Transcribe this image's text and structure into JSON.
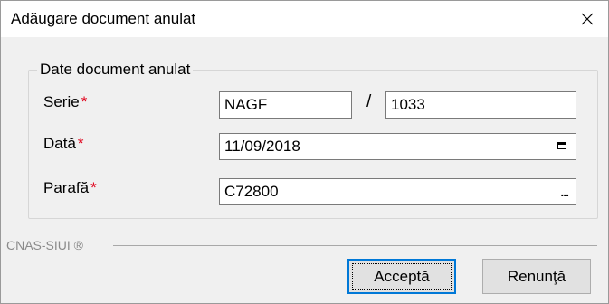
{
  "window": {
    "title": "Adăugare document anulat",
    "close_icon": "close-icon"
  },
  "group": {
    "legend": "Date document anulat"
  },
  "fields": {
    "serie": {
      "label": "Serie",
      "required_mark": "*",
      "series_value": "NAGF",
      "separator": "/",
      "number_value": "1033"
    },
    "data": {
      "label": "Dată",
      "required_mark": "*",
      "value": "11/09/2018",
      "icon": "calendar-icon"
    },
    "parafa": {
      "label": "Parafă",
      "required_mark": "*",
      "value": "C72800",
      "icon": "ellipsis-icon",
      "button_text": "..."
    }
  },
  "footer": {
    "brand": "CNAS-SIUI ®"
  },
  "buttons": {
    "accept": "Acceptă",
    "cancel": "Renunţă"
  }
}
